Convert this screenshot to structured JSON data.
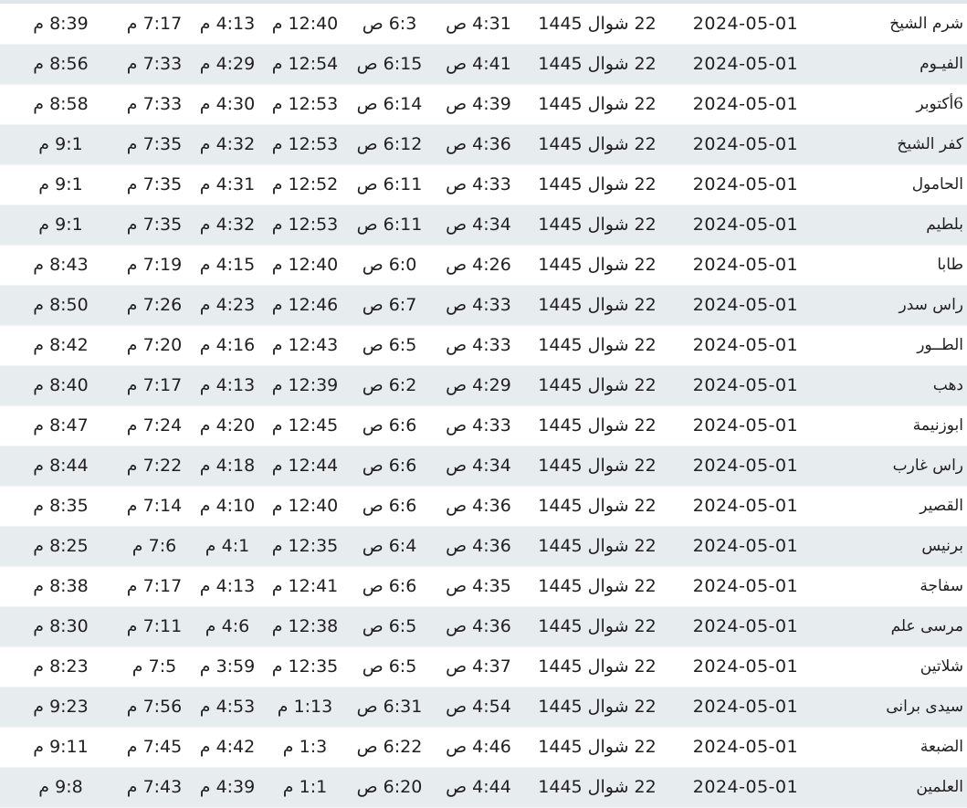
{
  "table": {
    "rows": [
      {
        "city": "شرم الشيخ",
        "gregorian": "2024-05-01",
        "hijri": "22 شوال 1445",
        "fajr": "4:31 ص",
        "sunrise": "6:3 ص",
        "dhuhr": "12:40 م",
        "asr": "4:13 م",
        "maghrib": "7:17 م",
        "isha": "8:39 م"
      },
      {
        "city": "الفيـوم",
        "gregorian": "2024-05-01",
        "hijri": "22 شوال 1445",
        "fajr": "4:41 ص",
        "sunrise": "6:15 ص",
        "dhuhr": "12:54 م",
        "asr": "4:29 م",
        "maghrib": "7:33 م",
        "isha": "8:56 م"
      },
      {
        "city": "6أكتوبر",
        "gregorian": "2024-05-01",
        "hijri": "22 شوال 1445",
        "fajr": "4:39 ص",
        "sunrise": "6:14 ص",
        "dhuhr": "12:53 م",
        "asr": "4:30 م",
        "maghrib": "7:33 م",
        "isha": "8:58 م"
      },
      {
        "city": "كفر الشيخ",
        "gregorian": "2024-05-01",
        "hijri": "22 شوال 1445",
        "fajr": "4:36 ص",
        "sunrise": "6:12 ص",
        "dhuhr": "12:53 م",
        "asr": "4:32 م",
        "maghrib": "7:35 م",
        "isha": "9:1 م"
      },
      {
        "city": "الحامول",
        "gregorian": "2024-05-01",
        "hijri": "22 شوال 1445",
        "fajr": "4:33 ص",
        "sunrise": "6:11 ص",
        "dhuhr": "12:52 م",
        "asr": "4:31 م",
        "maghrib": "7:35 م",
        "isha": "9:1 م"
      },
      {
        "city": "بلطيم",
        "gregorian": "2024-05-01",
        "hijri": "22 شوال 1445",
        "fajr": "4:34 ص",
        "sunrise": "6:11 ص",
        "dhuhr": "12:53 م",
        "asr": "4:32 م",
        "maghrib": "7:35 م",
        "isha": "9:1 م"
      },
      {
        "city": "طابا",
        "gregorian": "2024-05-01",
        "hijri": "22 شوال 1445",
        "fajr": "4:26 ص",
        "sunrise": "6:0 ص",
        "dhuhr": "12:40 م",
        "asr": "4:15 م",
        "maghrib": "7:19 م",
        "isha": "8:43 م"
      },
      {
        "city": "راس سدر",
        "gregorian": "2024-05-01",
        "hijri": "22 شوال 1445",
        "fajr": "4:33 ص",
        "sunrise": "6:7 ص",
        "dhuhr": "12:46 م",
        "asr": "4:23 م",
        "maghrib": "7:26 م",
        "isha": "8:50 م"
      },
      {
        "city": "الطــور",
        "gregorian": "2024-05-01",
        "hijri": "22 شوال 1445",
        "fajr": "4:33 ص",
        "sunrise": "6:5 ص",
        "dhuhr": "12:43 م",
        "asr": "4:16 م",
        "maghrib": "7:20 م",
        "isha": "8:42 م"
      },
      {
        "city": "دهب",
        "gregorian": "2024-05-01",
        "hijri": "22 شوال 1445",
        "fajr": "4:29 ص",
        "sunrise": "6:2 ص",
        "dhuhr": "12:39 م",
        "asr": "4:13 م",
        "maghrib": "7:17 م",
        "isha": "8:40 م"
      },
      {
        "city": "ابوزنيمة",
        "gregorian": "2024-05-01",
        "hijri": "22 شوال 1445",
        "fajr": "4:33 ص",
        "sunrise": "6:6 ص",
        "dhuhr": "12:45 م",
        "asr": "4:20 م",
        "maghrib": "7:24 م",
        "isha": "8:47 م"
      },
      {
        "city": "راس غارب",
        "gregorian": "2024-05-01",
        "hijri": "22 شوال 1445",
        "fajr": "4:34 ص",
        "sunrise": "6:6 ص",
        "dhuhr": "12:44 م",
        "asr": "4:18 م",
        "maghrib": "7:22 م",
        "isha": "8:44 م"
      },
      {
        "city": "القصير",
        "gregorian": "2024-05-01",
        "hijri": "22 شوال 1445",
        "fajr": "4:36 ص",
        "sunrise": "6:6 ص",
        "dhuhr": "12:40 م",
        "asr": "4:10 م",
        "maghrib": "7:14 م",
        "isha": "8:35 م"
      },
      {
        "city": "برنيس",
        "gregorian": "2024-05-01",
        "hijri": "22 شوال 1445",
        "fajr": "4:36 ص",
        "sunrise": "6:4 ص",
        "dhuhr": "12:35 م",
        "asr": "4:1 م",
        "maghrib": "7:6 م",
        "isha": "8:25 م"
      },
      {
        "city": "سفاجة",
        "gregorian": "2024-05-01",
        "hijri": "22 شوال 1445",
        "fajr": "4:35 ص",
        "sunrise": "6:6 ص",
        "dhuhr": "12:41 م",
        "asr": "4:13 م",
        "maghrib": "7:17 م",
        "isha": "8:38 م"
      },
      {
        "city": "مرسى علم",
        "gregorian": "2024-05-01",
        "hijri": "22 شوال 1445",
        "fajr": "4:36 ص",
        "sunrise": "6:5 ص",
        "dhuhr": "12:38 م",
        "asr": "4:6 م",
        "maghrib": "7:11 م",
        "isha": "8:30 م"
      },
      {
        "city": "شلاتين",
        "gregorian": "2024-05-01",
        "hijri": "22 شوال 1445",
        "fajr": "4:37 ص",
        "sunrise": "6:5 ص",
        "dhuhr": "12:35 م",
        "asr": "3:59 م",
        "maghrib": "7:5 م",
        "isha": "8:23 م"
      },
      {
        "city": "سيدى برانى",
        "gregorian": "2024-05-01",
        "hijri": "22 شوال 1445",
        "fajr": "4:54 ص",
        "sunrise": "6:31 ص",
        "dhuhr": "1:13 م",
        "asr": "4:53 م",
        "maghrib": "7:56 م",
        "isha": "9:23 م"
      },
      {
        "city": "الضبعة",
        "gregorian": "2024-05-01",
        "hijri": "22 شوال 1445",
        "fajr": "4:46 ص",
        "sunrise": "6:22 ص",
        "dhuhr": "1:3 م",
        "asr": "4:42 م",
        "maghrib": "7:45 م",
        "isha": "9:11 م"
      },
      {
        "city": "العلمين",
        "gregorian": "2024-05-01",
        "hijri": "22 شوال 1445",
        "fajr": "4:44 ص",
        "sunrise": "6:20 ص",
        "dhuhr": "1:1 م",
        "asr": "4:39 م",
        "maghrib": "7:43 م",
        "isha": "9:8 م"
      }
    ]
  }
}
